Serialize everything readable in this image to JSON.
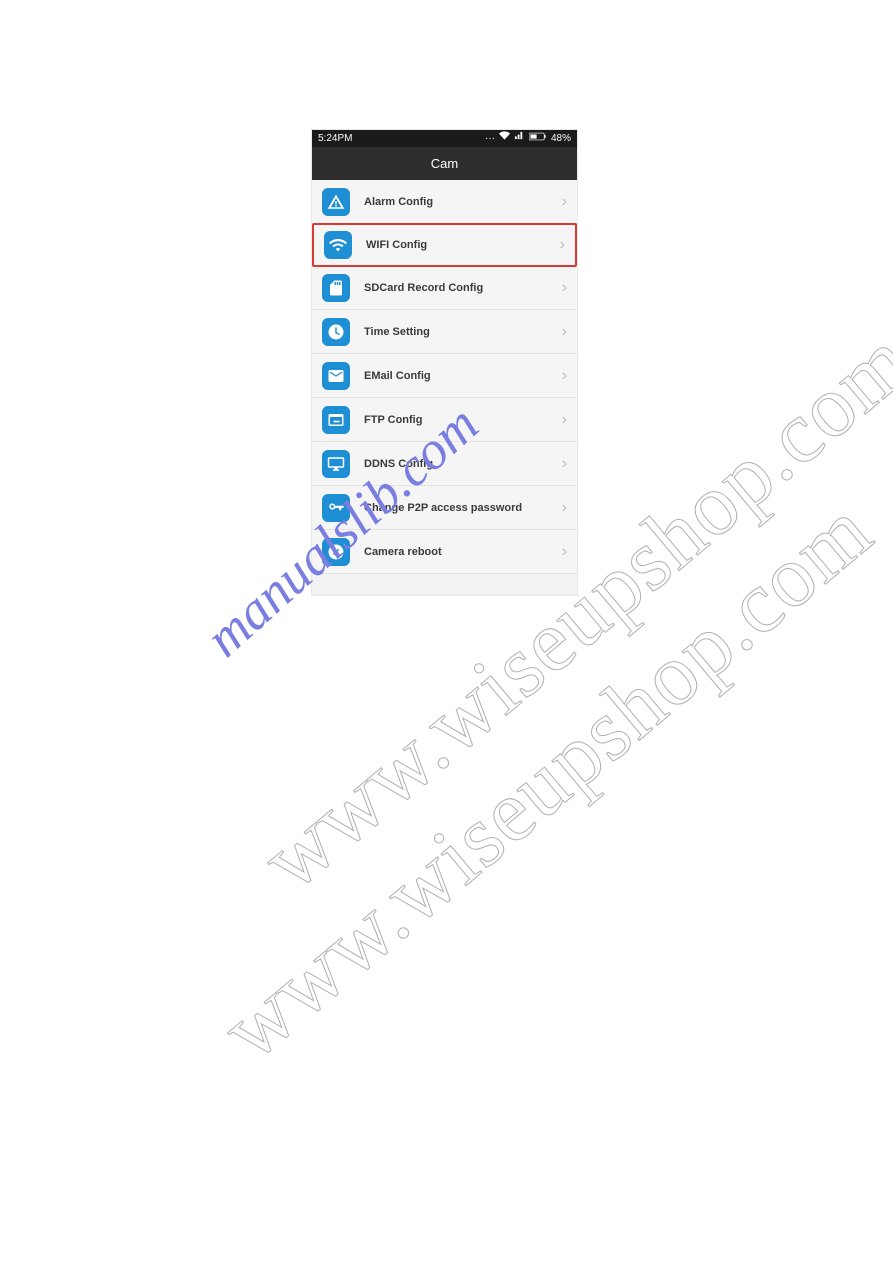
{
  "status": {
    "time": "5:24PM",
    "battery": "48%"
  },
  "header": {
    "title": "Cam"
  },
  "menu": [
    {
      "label": "Alarm Config",
      "icon": "alarm-icon",
      "highlight": false
    },
    {
      "label": "WIFI Config",
      "icon": "wifi-icon",
      "highlight": true
    },
    {
      "label": "SDCard Record Config",
      "icon": "sdcard-icon",
      "highlight": false
    },
    {
      "label": "Time Setting",
      "icon": "clock-icon",
      "highlight": false
    },
    {
      "label": "EMail Config",
      "icon": "email-icon",
      "highlight": false
    },
    {
      "label": "FTP Config",
      "icon": "ftp-icon",
      "highlight": false
    },
    {
      "label": "DDNS Config",
      "icon": "ddns-icon",
      "highlight": false
    },
    {
      "label": "Change P2P access password",
      "icon": "key-icon",
      "highlight": false
    },
    {
      "label": "Camera reboot",
      "icon": "reboot-icon",
      "highlight": false
    }
  ],
  "watermarks": {
    "big1": "www.wiseupshop.com",
    "big2": "www.wiseupshop.com",
    "small": "manualslib.com"
  }
}
